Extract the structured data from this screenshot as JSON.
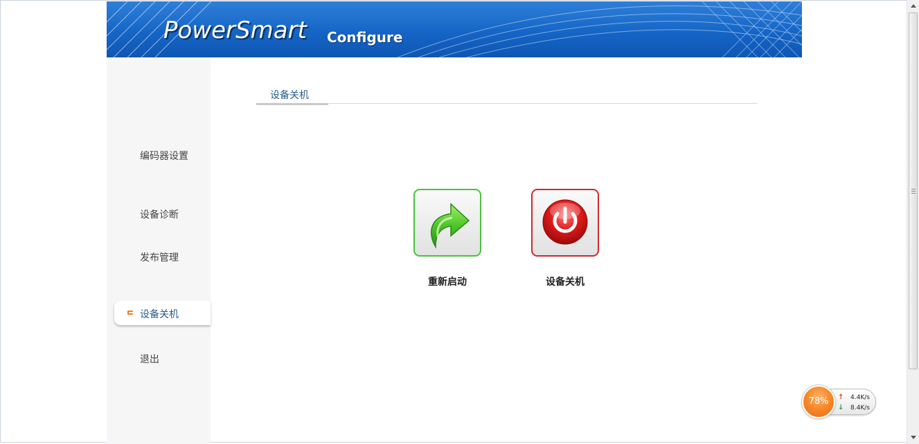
{
  "header": {
    "brand": "PowerSmart",
    "subtitle": "Configure"
  },
  "sidebar": {
    "items": [
      {
        "label": "编码器设置"
      },
      {
        "label": "设备诊断"
      },
      {
        "label": "发布管理"
      },
      {
        "label": "设备关机",
        "active": true
      },
      {
        "label": "退出"
      }
    ]
  },
  "main": {
    "tab_title": "设备关机",
    "actions": [
      {
        "label": "重新启动",
        "icon": "restart-arrow-icon",
        "border_color": "#49c23a"
      },
      {
        "label": "设备关机",
        "icon": "power-icon",
        "border_color": "#d2262c"
      }
    ]
  },
  "network_widget": {
    "percent": "78%",
    "upload": "4.4K/s",
    "download": "8.4K/s"
  },
  "colors": {
    "banner_blue": "#1565c6",
    "accent_orange": "#f07c1c",
    "link_blue": "#2a5b8a"
  }
}
